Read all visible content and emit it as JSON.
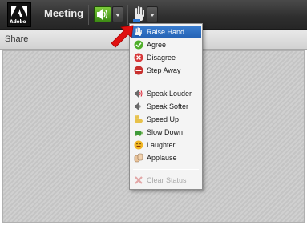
{
  "toolbar": {
    "logo_text": "Adobe",
    "meeting_label": "Meeting"
  },
  "pod": {
    "title": "Share"
  },
  "status_menu": {
    "items": [
      {
        "label": "Raise Hand",
        "icon": "raised-hand-icon",
        "selected": true
      },
      {
        "label": "Agree",
        "icon": "agree-check-icon"
      },
      {
        "label": "Disagree",
        "icon": "disagree-x-icon"
      },
      {
        "label": "Step Away",
        "icon": "step-away-icon"
      },
      {
        "label": "Speak Louder",
        "icon": "speak-louder-icon"
      },
      {
        "label": "Speak Softer",
        "icon": "speak-softer-icon"
      },
      {
        "label": "Speed Up",
        "icon": "speed-up-rabbit-icon"
      },
      {
        "label": "Slow Down",
        "icon": "slow-down-turtle-icon"
      },
      {
        "label": "Laughter",
        "icon": "laughter-smiley-icon"
      },
      {
        "label": "Applause",
        "icon": "applause-hands-icon"
      },
      {
        "label": "Clear Status",
        "icon": "clear-status-icon",
        "disabled": true
      }
    ]
  },
  "colors": {
    "toolbar_bg": "#333333",
    "speaker_green": "#5aab24",
    "selection_blue": "#2c6fc4",
    "arrow_red": "#e01010"
  }
}
